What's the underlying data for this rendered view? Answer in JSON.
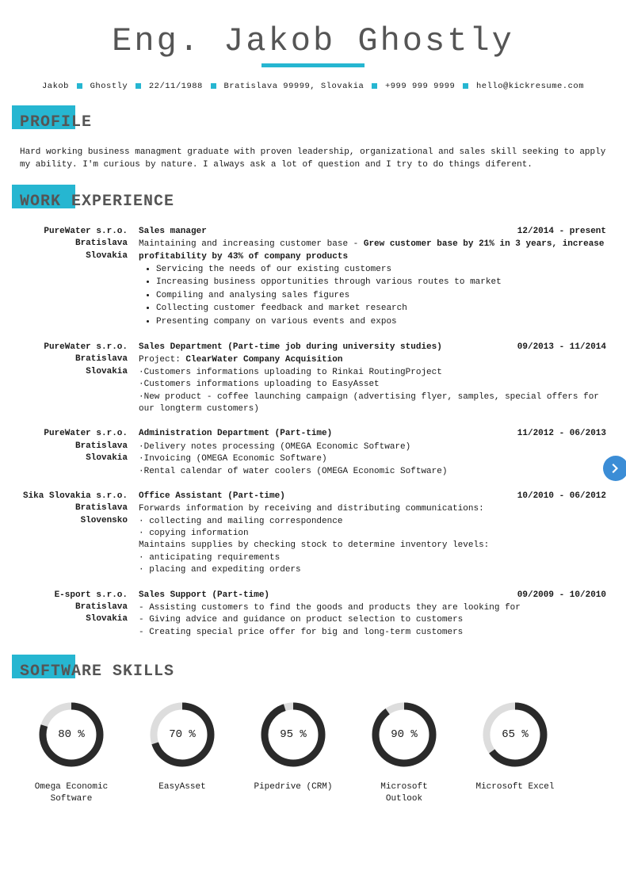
{
  "name": "Eng. Jakob Ghostly",
  "contacts": {
    "first": "Jakob",
    "last": "Ghostly",
    "dob": "22/11/1988",
    "addr": "Bratislava 99999, Slovakia",
    "phone": "+999 999 9999",
    "email": "hello@kickresume.com"
  },
  "sections": {
    "profile": "PROFILE",
    "work": "WORK EXPERIENCE",
    "skills": "SOFTWARE SKILLS"
  },
  "profile_text": "Hard working business managment graduate with proven leadership, organizational and sales skill seeking to apply my ability. I'm curious by nature. I always ask a lot of question and I try to do things diferent.",
  "jobs": [
    {
      "company": "PureWater s.r.o.",
      "city": "Bratislava",
      "country": "Slovakia",
      "title": "Sales manager",
      "dates": "12/2014 - present",
      "intro_plain": "Maintaining and increasing customer base - ",
      "intro_bold": "Grew customer base by 21% in 3 years, increase profitability by 43% of company products",
      "bullets": [
        "Servicing the needs of our existing customers",
        "Increasing business opportunities through various routes to market",
        "Compiling and analysing sales figures",
        "Collecting customer feedback and market research",
        "Presenting company on various events and expos"
      ]
    },
    {
      "company": "PureWater s.r.o.",
      "city": "Bratislava",
      "country": "Slovakia",
      "title": "Sales Department (Part-time job during university studies)",
      "dates": "09/2013 - 11/2014",
      "proj_label": "Project: ",
      "proj_name": "ClearWater Company Acquisition",
      "lines": [
        "·Customers informations uploading to Rinkai RoutingProject",
        "·Customers informations uploading to EasyAsset",
        "·New product - coffee launching campaign (advertising flyer, samples, special offers for our longterm customers)"
      ]
    },
    {
      "company": "PureWater s.r.o.",
      "city": "Bratislava",
      "country": "Slovakia",
      "title": "Administration Department (Part-time)",
      "dates": "11/2012 - 06/2013",
      "lines": [
        "·Delivery notes processing (OMEGA Economic Software)",
        "·Invoicing (OMEGA Economic Software)",
        "·Rental calendar of water coolers (OMEGA Economic Software)"
      ]
    },
    {
      "company": "Sika Slovakia s.r.o.",
      "city": "Bratislava",
      "country": "Slovensko",
      "title": "Office Assistant (Part-time)",
      "dates": "10/2010 - 06/2012",
      "block1_head": "Forwards information by receiving and distributing communications:",
      "block1_lines": [
        "· collecting and mailing correspondence",
        "· copying information"
      ],
      "block2_head": "Maintains supplies by checking stock to determine inventory levels:",
      "block2_lines": [
        "· anticipating requirements",
        "· placing and expediting orders"
      ]
    },
    {
      "company": "E-sport s.r.o.",
      "city": "Bratislava",
      "country": "Slovakia",
      "title": "Sales Support (Part-time)",
      "dates": "09/2009 - 10/2010",
      "lines": [
        "- Assisting customers to find the goods and products they are looking for",
        "- Giving advice and guidance on product selection to customers",
        "- Creating special price offer for big and long-term customers"
      ]
    }
  ],
  "skills": [
    {
      "label": "Omega Economic Software",
      "pct": 80
    },
    {
      "label": "EasyAsset",
      "pct": 70
    },
    {
      "label": "Pipedrive (CRM)",
      "pct": 95
    },
    {
      "label": "Microsoft Outlook",
      "pct": 90
    },
    {
      "label": "Microsoft Excel",
      "pct": 65
    }
  ]
}
